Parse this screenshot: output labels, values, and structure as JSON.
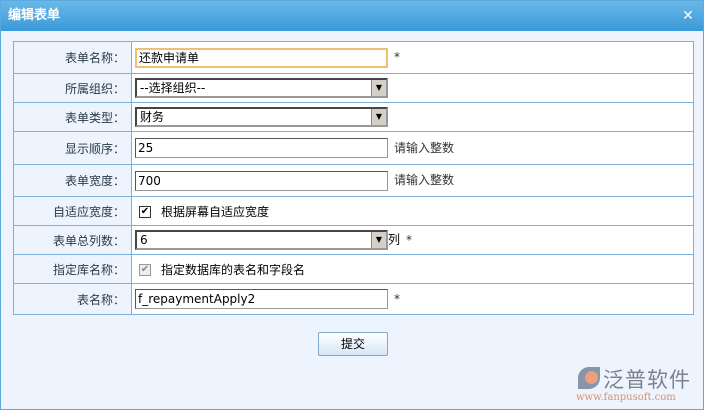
{
  "dialog": {
    "title": "编辑表单",
    "close_icon": "close-icon"
  },
  "form": {
    "form_name": {
      "label": "表单名称：",
      "value": "还款申请单",
      "required": "*"
    },
    "org": {
      "label": "所属组织：",
      "value": "--选择组织--"
    },
    "type": {
      "label": "表单类型：",
      "value": "财务"
    },
    "order": {
      "label": "显示顺序：",
      "value": "25",
      "hint": "请输入整数"
    },
    "width": {
      "label": "表单宽度：",
      "value": "700",
      "hint": "请输入整数"
    },
    "adaptive": {
      "label": "自适应宽度：",
      "checked": true,
      "text": "根据屏幕自适应宽度"
    },
    "columns": {
      "label": "表单总列数：",
      "value": "6",
      "unit": "列",
      "required": "*"
    },
    "dbname": {
      "label": "指定库名称：",
      "checked": true,
      "disabled": true,
      "text": "指定数据库的表名和字段名"
    },
    "table_name": {
      "label": "表名称：",
      "value": "f_repaymentApply2",
      "required": "*"
    }
  },
  "submit_label": "提交",
  "logo": {
    "name": "泛普软件",
    "url": "www.fanpusoft.com"
  }
}
